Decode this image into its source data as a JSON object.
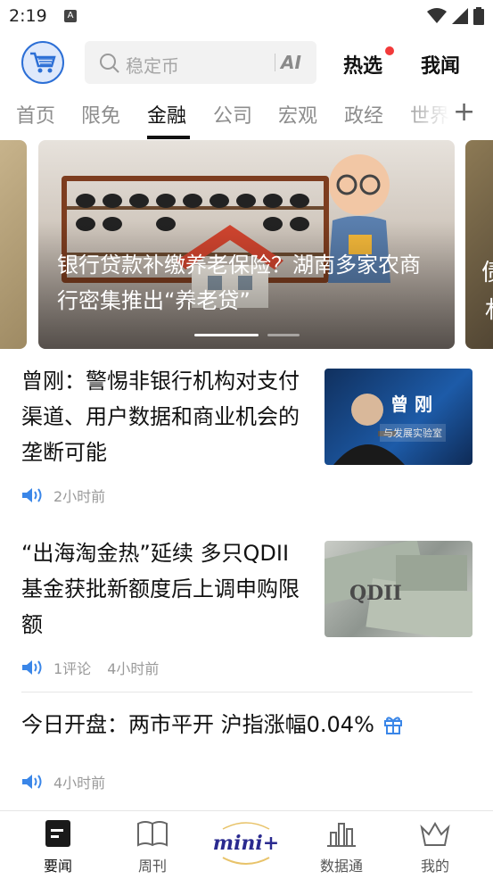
{
  "status": {
    "time": "2:19",
    "notif_icon": "A"
  },
  "topbar": {
    "search_placeholder": "稳定币",
    "ai_label": "AI",
    "hot_label": "热选",
    "mine_label": "我闻"
  },
  "tabs": [
    "首页",
    "限免",
    "金融",
    "公司",
    "宏观",
    "政经",
    "世界"
  ],
  "active_tab": "金融",
  "carousel": {
    "title": "银行贷款补缴养老保险？湖南多家农商行密集推出“养老贷”",
    "side_right_chars": [
      "债",
      "札"
    ]
  },
  "articles": [
    {
      "title": "曾刚：警惕非银行机构对支付渠道、用户数据和商业机会的垄断可能",
      "comments": "",
      "time": "2小时前",
      "thumb_text": "曾 刚",
      "thumb_sub": "与发展实验室"
    },
    {
      "title": "“出海淘金热”延续 多只QDII基金获批新额度后上调申购限额",
      "comments": "1评论",
      "time": "4小时前",
      "thumb_text": "QDII"
    },
    {
      "title": "今日开盘：两市平开 沪指涨幅0.04%",
      "comments": "",
      "time": "4小时前"
    }
  ],
  "bottom_nav": {
    "news": "要闻",
    "weekly": "周刊",
    "mini": "mini+",
    "data": "数据通",
    "mine": "我的"
  },
  "colors": {
    "accent": "#2c6fd6",
    "speaker": "#3a86e8",
    "red_dot": "#f23a3a"
  }
}
